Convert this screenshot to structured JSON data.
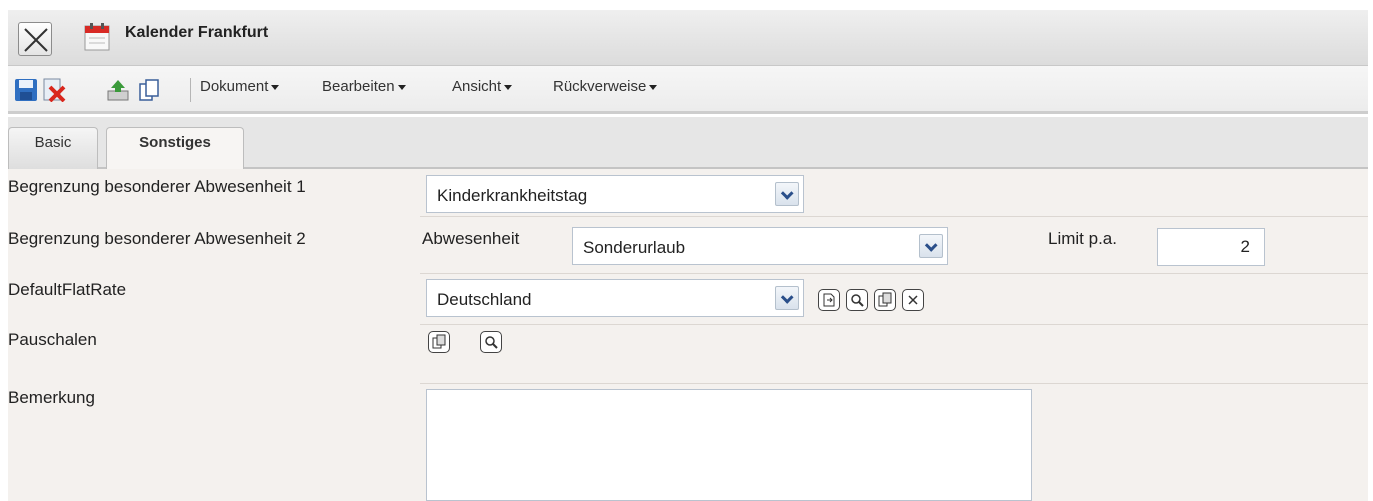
{
  "window": {
    "title": "Kalender Frankfurt",
    "close_icon": "close-x-icon",
    "app_icon": "calendar-icon"
  },
  "toolbar": {
    "icons": [
      "save-icon",
      "delete-icon",
      "upload-icon",
      "copy-icon"
    ],
    "menus": [
      {
        "label": "Dokument"
      },
      {
        "label": "Bearbeiten"
      },
      {
        "label": "Ansicht"
      },
      {
        "label": "Rückverweise"
      }
    ]
  },
  "tabs": [
    {
      "label": "Basic",
      "active": false
    },
    {
      "label": "Sonstiges",
      "active": true
    }
  ],
  "form": {
    "limit1": {
      "label": "Begrenzung besonderer Abwesenheit 1",
      "value": "Kinderkrankheitstag"
    },
    "limit2": {
      "label": "Begrenzung besonderer Abwesenheit 2",
      "absence_label": "Abwesenheit",
      "absence_value": "Sonderurlaub",
      "limit_label": "Limit p.a.",
      "limit_value": "2"
    },
    "default_flat_rate": {
      "label": "DefaultFlatRate",
      "value": "Deutschland",
      "actions": [
        "open-icon",
        "search-icon",
        "copy-icon",
        "clear-icon"
      ]
    },
    "pauschalen": {
      "label": "Pauschalen",
      "actions": [
        "copy-icon",
        "search-icon"
      ]
    },
    "bemerkung": {
      "label": "Bemerkung",
      "value": ""
    }
  },
  "colors": {
    "form_bg": "#f4f1ee",
    "dropdown_arrow": "#2a4f8a",
    "save_icon": "#2f6fc1",
    "delete_icon": "#d9261c",
    "calendar_red": "#d82a25"
  }
}
